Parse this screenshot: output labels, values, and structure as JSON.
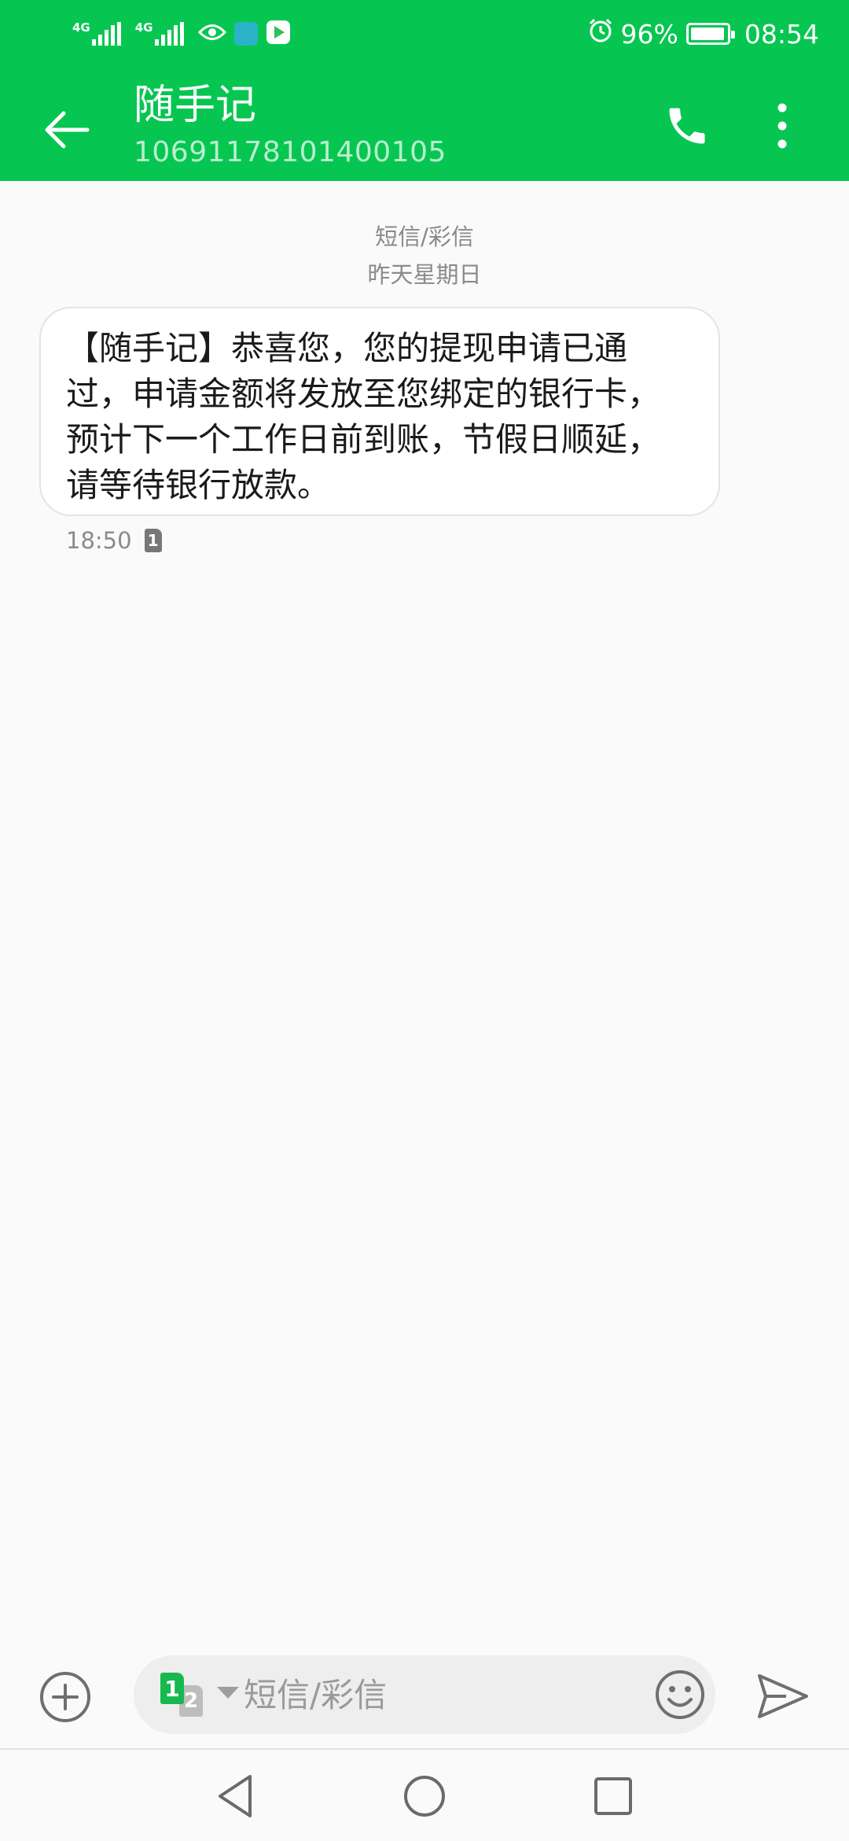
{
  "status_bar": {
    "network_1": "4G",
    "network_2": "4G",
    "battery": "96%",
    "battery_level": 0.96,
    "time": "08:54",
    "icons": [
      "signal-icon",
      "signal-icon",
      "eye-icon",
      "app-notification-icon",
      "video-app-icon",
      "alarm-icon",
      "battery-icon"
    ]
  },
  "app_bar": {
    "title": "随手记",
    "number": "10691178101400105",
    "icons": [
      "back-arrow-icon",
      "phone-icon",
      "more-vert-icon"
    ]
  },
  "conversation": {
    "type_label": "短信/彩信",
    "date_label": "昨天星期日",
    "messages": [
      {
        "text": "【随手记】恭喜您，您的提现申请已通过，申请金额将发放至您绑定的银行卡，预计下一个工作日前到账，节假日顺延，请等待银行放款。",
        "time": "18:50",
        "sim": "1"
      }
    ]
  },
  "composer": {
    "placeholder": "短信/彩信",
    "sim_primary": "1",
    "sim_secondary": "2",
    "icons": [
      "add-circle-icon",
      "sim-switch-icon",
      "emoji-icon",
      "send-icon"
    ]
  },
  "nav_bar": {
    "icons": [
      "nav-back-icon",
      "nav-home-icon",
      "nav-recent-icon"
    ]
  },
  "colors": {
    "accent": "#06c651",
    "background": "#fafafa",
    "bubble": "#ffffff",
    "meta_text": "#8a8a8a"
  }
}
